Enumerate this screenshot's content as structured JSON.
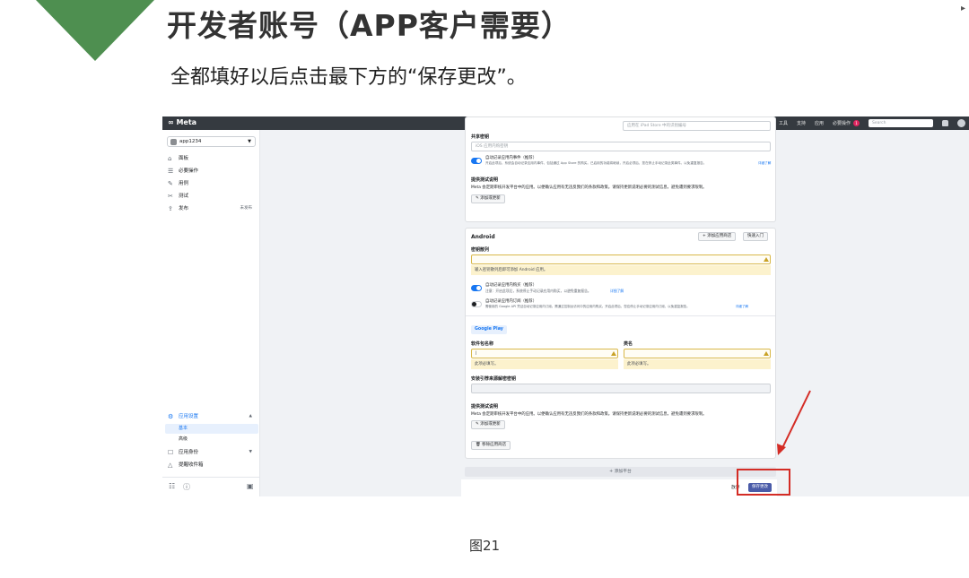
{
  "slide": {
    "title": "开发者账号（APP客户需要）",
    "subtitle": "全都填好以后点击最下方的“保存更改”。",
    "corner_mark": "▸",
    "caption": "图21"
  },
  "topbar": {
    "logo": "∞ Meta",
    "nav": [
      "文档",
      "工具",
      "支持",
      "应用"
    ],
    "required_actions": "必要操作",
    "required_count": "1",
    "search_placeholder": "Search"
  },
  "sidebar": {
    "app_name": "app1234",
    "items": [
      {
        "icon": "dashboard-icon",
        "glyph": "⌂",
        "label": "面板"
      },
      {
        "icon": "checklist-icon",
        "glyph": "☰",
        "label": "必要操作"
      },
      {
        "icon": "pencil-icon",
        "glyph": "✎",
        "label": "用例"
      },
      {
        "icon": "test-icon",
        "glyph": "✂",
        "label": "测试"
      },
      {
        "icon": "publish-icon",
        "glyph": "⇪",
        "label": "发布",
        "right": "未发布"
      }
    ],
    "settings": {
      "label": "应用设置",
      "sub": [
        "基本",
        "高级"
      ]
    },
    "roles": {
      "label": "应用身份"
    },
    "alerts": {
      "label": "提醒收件箱"
    }
  },
  "ios_card": {
    "ipad_placeholder": "应用在 iPad Store 中的识别编号",
    "shared_secret_label": "共享密钥",
    "shared_secret_placeholder": "iOS 应用内购密钥",
    "auto_log_label": "自动记录应用内事件（推荐）",
    "auto_log_desc": "开启此项后，系统会自动记录应用内事件，包括通过 App Store 的购买。已启用的功能将继续，开启必须后，您在停止手动记录此类事件。以免重复报告。",
    "auto_log_link": "详细了解",
    "test_title": "提供测试说明",
    "test_desc": "Meta 会定期审核开发平台中的应用。以便确认应用有无违反我们的条款和政策。请保持更新说明必要的测试信息，避免遭到要求限制。",
    "add_note_button": "添加或更新"
  },
  "android_card": {
    "title": "Android",
    "add_store_button": "添加应用商店",
    "quick_start_button": "快速入门",
    "key_hash_label": "密钥散列",
    "key_hash_warning": "输入密钥散列后即可添加 Android 应用。",
    "auto_log_label": "自动记录应用内购买（推荐）",
    "auto_log_desc": "注意：开启此项后，系统停止手动记录应用内购买，以避免重复报告。",
    "auto_log_link": "详细了解",
    "sub_label": "自动记录应用内订阅（推荐）",
    "sub_desc": "需使用的 Google API 凭证自动记录应用内订阅。需通过控制台访问中的应用内购买。开启此项后，您应停止手动记录应用内订阅，以免重复报告。",
    "sub_link": "详细了解",
    "store_tab": "Google Play",
    "package_label": "软件包名称",
    "package_value": "|",
    "package_warning": "此项必填写。",
    "class_label": "类名",
    "class_warning": "此项必填写。",
    "install_label": "安装引荐来源解密密钥",
    "test_title": "提供测试说明",
    "test_desc": "Meta 会定期审核开发平台中的应用。以便确认应用有无违反我们的条款和政策。请保持更新说明必要的测试信息，避免遭到要求限制。",
    "add_note_button": "添加或更新",
    "remove_store_button": "移除应用商店"
  },
  "footer": {
    "add_platform": "+ 添加平台",
    "cancel": "放弃",
    "save": "保存更改"
  }
}
